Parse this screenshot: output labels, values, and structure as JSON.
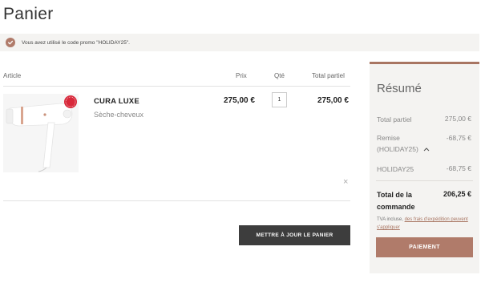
{
  "page": {
    "title": "Panier"
  },
  "notice": {
    "text": "Vous avez utilisé le code promo \"HOLIDAY25\"."
  },
  "cart": {
    "headers": {
      "article": "Article",
      "prix": "Prix",
      "qte": "Qté",
      "total": "Total partiel"
    },
    "item": {
      "name": "CURA LUXE",
      "subtitle": "Sèche-cheveux",
      "price": "275,00 €",
      "quantity": "1",
      "total": "275,00 €",
      "remove": "×"
    },
    "update_label": "METTRE À JOUR LE PANIER"
  },
  "summary": {
    "title": "Résumé",
    "subtotal_label": "Total partiel",
    "subtotal_value": "275,00 €",
    "discount_label": "Remise (HOLIDAY25)",
    "discount_toggle": "^",
    "discount_value": "-68,75 €",
    "code_label": "HOLIDAY25",
    "code_value": "-68,75 €",
    "total_label": "Total de la commande",
    "total_value": "206,25 €",
    "tva_text": "TVA incluse, ",
    "tva_link": "des frais d'expédition peuvent s'appliquer",
    "pay_label": "PAIEMENT"
  },
  "colors": {
    "accent": "#b07b6a",
    "dark_button": "#3d3d3d",
    "panel": "#f4f3f1"
  },
  "icons": {
    "notice": "check-circle-icon",
    "remove": "close-icon",
    "toggle": "chevron-up-icon"
  }
}
